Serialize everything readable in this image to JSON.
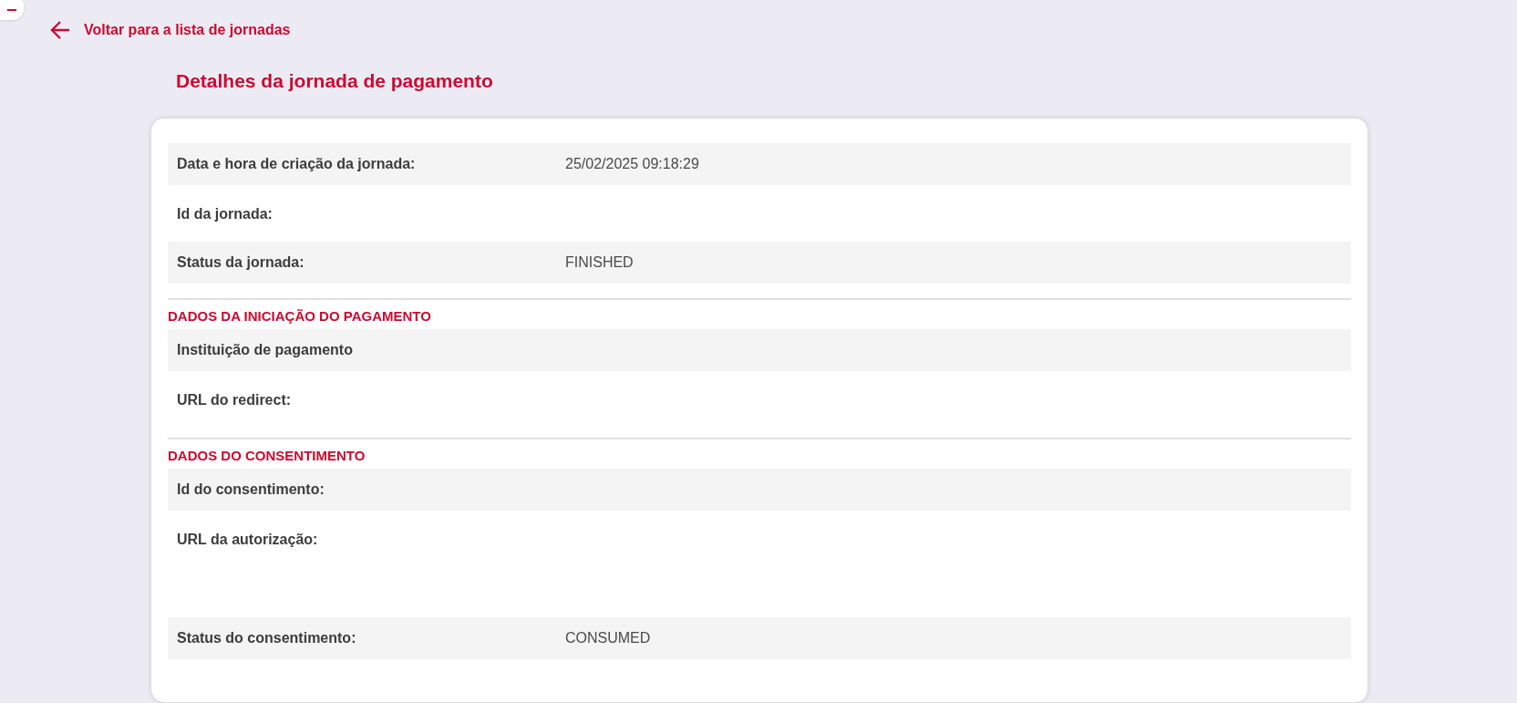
{
  "back_link": {
    "label": "Voltar para a lista de jornadas"
  },
  "page_title": "Detalhes da jornada de pagamento",
  "sections": [
    {
      "rows": [
        {
          "label": "Data e hora de criação da jornada:",
          "value": "25/02/2025 09:18:29"
        },
        {
          "label": "Id da jornada:"
        },
        {
          "label": "Status da jornada:",
          "value": "FINISHED"
        }
      ]
    },
    {
      "heading": "DADOS DA INICIAÇÃO DO PAGAMENTO",
      "rows": [
        {
          "label": "Instituição de pagamento"
        },
        {
          "label": "URL do redirect:"
        }
      ]
    },
    {
      "heading": "DADOS DO CONSENTIMENTO",
      "rows": [
        {
          "label": "Id do consentimento:"
        },
        {
          "label": "URL da autorização:"
        },
        {
          "label": "Status do consentimento:",
          "value": "CONSUMED"
        }
      ]
    }
  ]
}
